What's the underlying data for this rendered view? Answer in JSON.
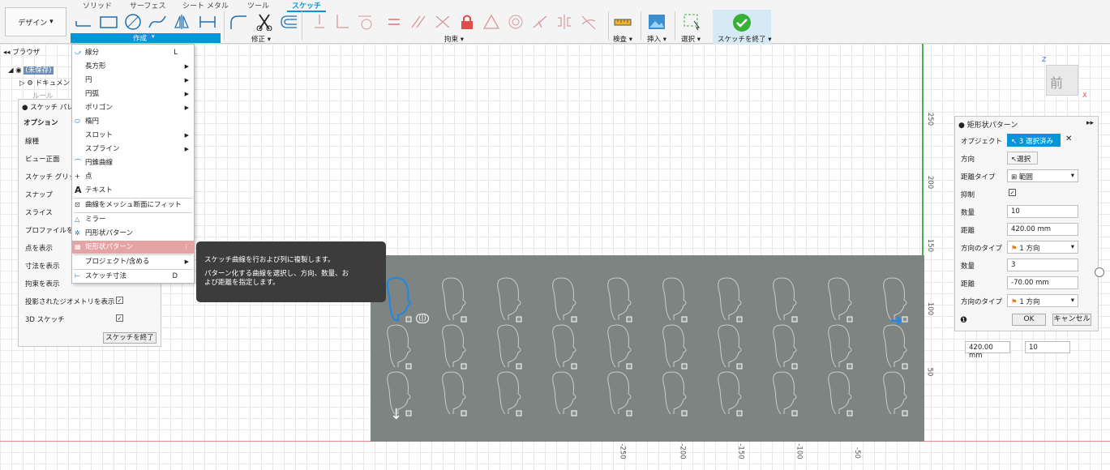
{
  "colors": {
    "accent": "#0696d7",
    "highlight": "#e6a3a3",
    "green": "#36b037"
  },
  "toolbar": {
    "design_label": "デザイン",
    "tabs": [
      "ソリッド",
      "サーフェス",
      "シート メタル",
      "ツール",
      "スケッチ"
    ],
    "groups": {
      "create": "作成",
      "modify": "修正",
      "constrain": "拘束",
      "inspect": "検査",
      "insert": "挿入",
      "select": "選択",
      "finish": "スケッチを終了"
    }
  },
  "browser": {
    "title": "ブラウザ",
    "item1": "(未保存)",
    "item2": "ドキュメント",
    "item3": "ルール"
  },
  "palette": {
    "title": "スケッチ パレット",
    "section": "オプション",
    "rows": [
      "線種",
      "ビュー正面",
      "スケッチ グリッド",
      "スナップ",
      "スライス",
      "プロファイルを表示",
      "点を表示",
      "寸法を表示",
      "拘束を表示",
      "投影されたジオメトリを表示",
      "3D スケッチ"
    ],
    "finish_button": "スケッチを終了"
  },
  "menu": {
    "items": [
      {
        "label": "線分",
        "key": "L"
      },
      {
        "label": "長方形"
      },
      {
        "label": "円"
      },
      {
        "label": "円弧"
      },
      {
        "label": "ポリゴン"
      },
      {
        "label": "楕円"
      },
      {
        "label": "スロット"
      },
      {
        "label": "スプライン"
      },
      {
        "label": "円錐曲線"
      },
      {
        "label": "点"
      },
      {
        "label": "テキスト"
      },
      {
        "label": "曲線をメッシュ断面にフィット"
      },
      {
        "label": "ミラー"
      },
      {
        "label": "円形状パターン"
      },
      {
        "label": "矩形状パターン"
      },
      {
        "label": "プロジェクト/含める"
      },
      {
        "label": "スケッチ寸法",
        "key": "D"
      }
    ]
  },
  "tooltip": {
    "line1": "スケッチ曲線を行および列に複製します。",
    "line2": "パターン化する曲線を選択し、方向、数量、お",
    "line3": "よび距離を指定します。"
  },
  "dialog": {
    "title": "矩形状パターン",
    "labels": {
      "object": "オブジェクト",
      "direction": "方向",
      "distance_type": "距離タイプ",
      "suppress": "抑制",
      "quantity1": "数量",
      "distance1": "距離",
      "dir_type1": "方向のタイプ",
      "quantity2": "数量",
      "distance2": "距離",
      "dir_type2": "方向のタイプ"
    },
    "values": {
      "object": "3 選択済み",
      "direction": "選択",
      "distance_type": "範囲",
      "quantity1": "10",
      "distance1": "420.00 mm",
      "dir_type1": "1 方向",
      "quantity2": "3",
      "distance2": "-70.00 mm",
      "dir_type2": "1 方向"
    },
    "ok": "OK",
    "cancel": "キャンセル"
  },
  "mini": {
    "distance": "420.00 mm",
    "count": "10"
  },
  "viewcube": {
    "face": "前",
    "x": "X",
    "z": "Z"
  },
  "ruler": {
    "v": [
      "250",
      "200",
      "150",
      "100",
      "50"
    ],
    "h": [
      "-250",
      "-200",
      "-150",
      "-100",
      "-50"
    ]
  }
}
